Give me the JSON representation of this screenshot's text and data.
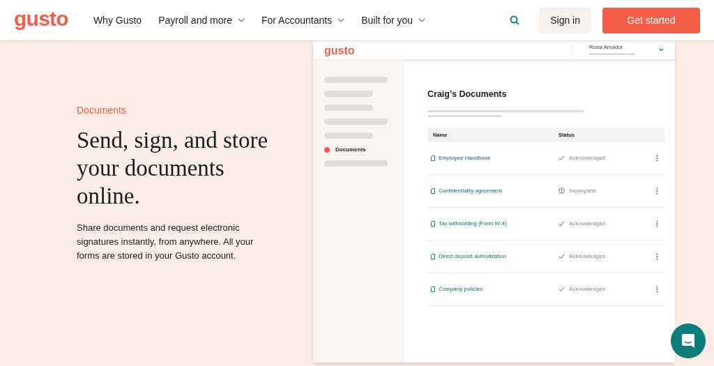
{
  "nav": {
    "logo": "gusto",
    "links": [
      {
        "label": "Why Gusto",
        "has_menu": false
      },
      {
        "label": "Payroll and more",
        "has_menu": true
      },
      {
        "label": "For Accountants",
        "has_menu": true
      },
      {
        "label": "Built for you",
        "has_menu": true
      }
    ],
    "sign_in": "Sign in",
    "cta": "Get started"
  },
  "hero": {
    "eyebrow": "Documents",
    "heading": "Send, sign, and store your documents online.",
    "body": "Share documents and request electronic signatures instantly, from anywhere. All your forms are stored in your Gusto account."
  },
  "app": {
    "logo": "gusto",
    "user": "Rosa Amador",
    "sidebar": {
      "items": [
        {
          "label": "Documents",
          "selected": true
        }
      ]
    },
    "title": "Craig’s Documents",
    "table": {
      "columns": [
        "Name",
        "Status"
      ],
      "rows": [
        {
          "name": "Employee Handbook",
          "status": "Acknowledged",
          "kind": "acknowledged"
        },
        {
          "name": "Confidentiality agreement",
          "status": "Incomplete",
          "kind": "incomplete"
        },
        {
          "name": "Tax withholding (Form W-4)",
          "status": "Acknowledged",
          "kind": "acknowledged"
        },
        {
          "name": "Direct deposit authorization",
          "status": "Acknowledged",
          "kind": "acknowledged"
        },
        {
          "name": "Company policies",
          "status": "Acknowledged",
          "kind": "acknowledged"
        }
      ]
    }
  }
}
